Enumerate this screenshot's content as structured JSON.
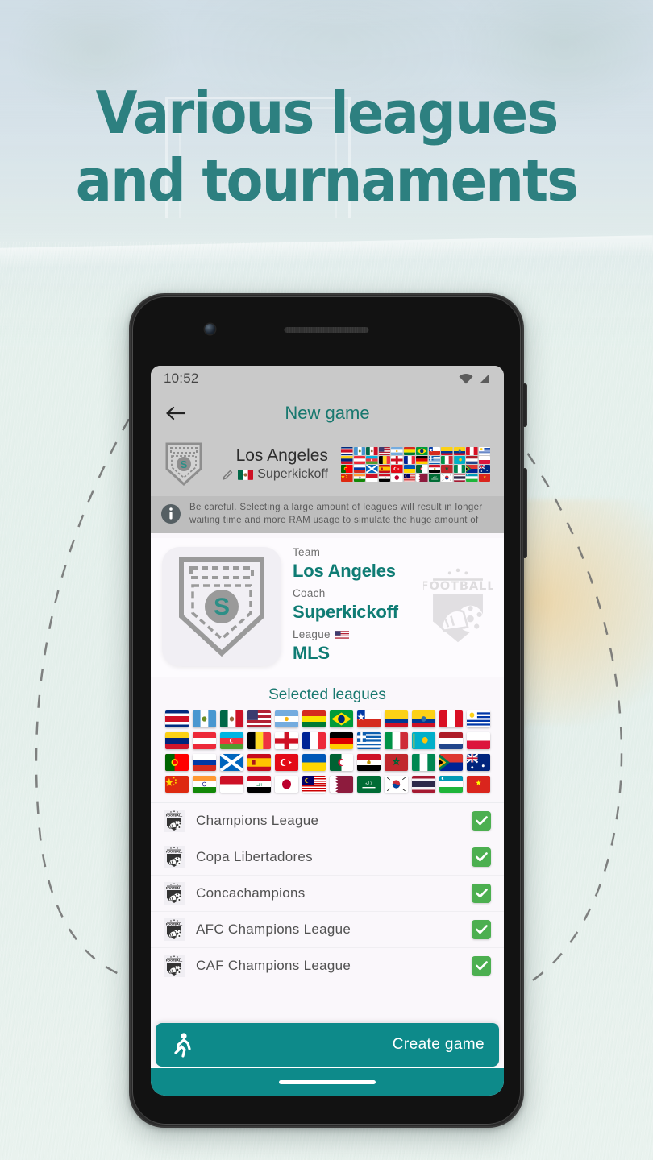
{
  "promo": {
    "headline_line1": "Various leagues",
    "headline_line2": "and tournaments",
    "accent_color": "#2d8080"
  },
  "phone": {
    "status_bar": {
      "time": "10:52",
      "wifi_icon": "wifi-icon",
      "signal_icon": "signal-icon"
    },
    "app_bar": {
      "back_icon": "back-arrow-icon",
      "title": "New game"
    },
    "team_header": {
      "badge_icon": "team-shield-badge-icon",
      "team_name": "Los Angeles",
      "edit_icon": "pencil-edit-icon",
      "coach_flag": "mexico-flag-icon",
      "coach_name": "Superkickoff"
    },
    "warning": {
      "icon": "info-icon",
      "text": "Be careful. Selecting a large amount of leagues will result in longer waiting time and more RAM usage to simulate the huge amount of"
    },
    "info_card": {
      "crest_icon": "team-shield-crest-icon",
      "logo_icon": "football-crest-logo-icon",
      "fields": [
        {
          "label": "Team",
          "value": "Los Angeles",
          "flag": ""
        },
        {
          "label": "Coach",
          "value": "Superkickoff",
          "flag": ""
        },
        {
          "label": "League",
          "value": "MLS",
          "flag": "usa-flag-icon"
        }
      ]
    },
    "selected_leagues": {
      "title": "Selected leagues",
      "flag_rows": [
        [
          "Costa Rica",
          "Guatemala",
          "Mexico",
          "United States",
          "Argentina",
          "Bolivia",
          "Brazil",
          "Chile",
          "Colombia",
          "Ecuador",
          "Peru",
          "Uruguay"
        ],
        [
          "Venezuela",
          "Austria",
          "Azerbaijan",
          "Belgium",
          "England",
          "France",
          "Germany",
          "Greece",
          "Italy",
          "Kazakhstan",
          "Netherlands",
          "Poland"
        ],
        [
          "Portugal",
          "Russia",
          "Scotland",
          "Spain",
          "Turkey",
          "Ukraine",
          "Algeria",
          "Egypt",
          "Morocco",
          "Nigeria",
          "South Africa",
          "Australia"
        ],
        [
          "China",
          "India",
          "Indonesia",
          "Iraq",
          "Japan",
          "Malaysia",
          "Qatar",
          "Saudi Arabia",
          "South Korea",
          "Thailand",
          "Uzbekistan",
          "Vietnam"
        ]
      ]
    },
    "league_rows": [
      {
        "icon": "football-crest-icon",
        "name": "Champions League",
        "checked": true
      },
      {
        "icon": "football-crest-icon",
        "name": "Copa Libertadores",
        "checked": true
      },
      {
        "icon": "football-crest-icon",
        "name": "Concachampions",
        "checked": true
      },
      {
        "icon": "football-crest-icon",
        "name": "AFC Champions League",
        "checked": true
      },
      {
        "icon": "football-crest-icon",
        "name": "CAF Champions League",
        "checked": true
      }
    ],
    "create_button": {
      "icon": "running-person-icon",
      "label": "Create game",
      "color": "#0d8a8a"
    },
    "nav_bar": {
      "pill": "home-gesture-pill"
    }
  }
}
